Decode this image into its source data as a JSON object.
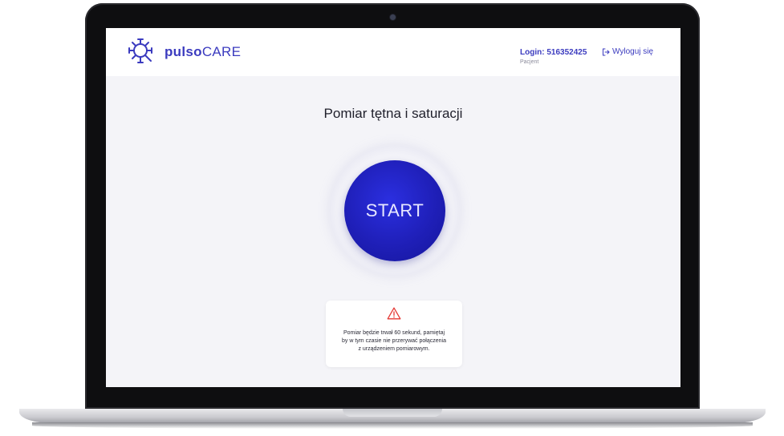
{
  "header": {
    "brand_bold": "pulso",
    "brand_light": "CARE",
    "login": "Login: 516352425",
    "role": "Pacjent",
    "logout_label": "Wyloguj się"
  },
  "main": {
    "title": "Pomiar tętna i saturacji",
    "start_label": "START",
    "notice_line1": "Pomiar będzie trwał 60 sekund, pamiętaj",
    "notice_line2": "by w tym czasie nie przerywać połączenia",
    "notice_line3": "z urządzeniem pomiarowym."
  },
  "colors": {
    "accent": "#3b3bbf",
    "start_button": "#2222c8",
    "warning": "#e53935",
    "background": "#f4f4f8"
  },
  "icons": {
    "logo": "virus-magnifier-icon",
    "logout": "logout-icon",
    "warning": "warning-triangle-icon"
  }
}
